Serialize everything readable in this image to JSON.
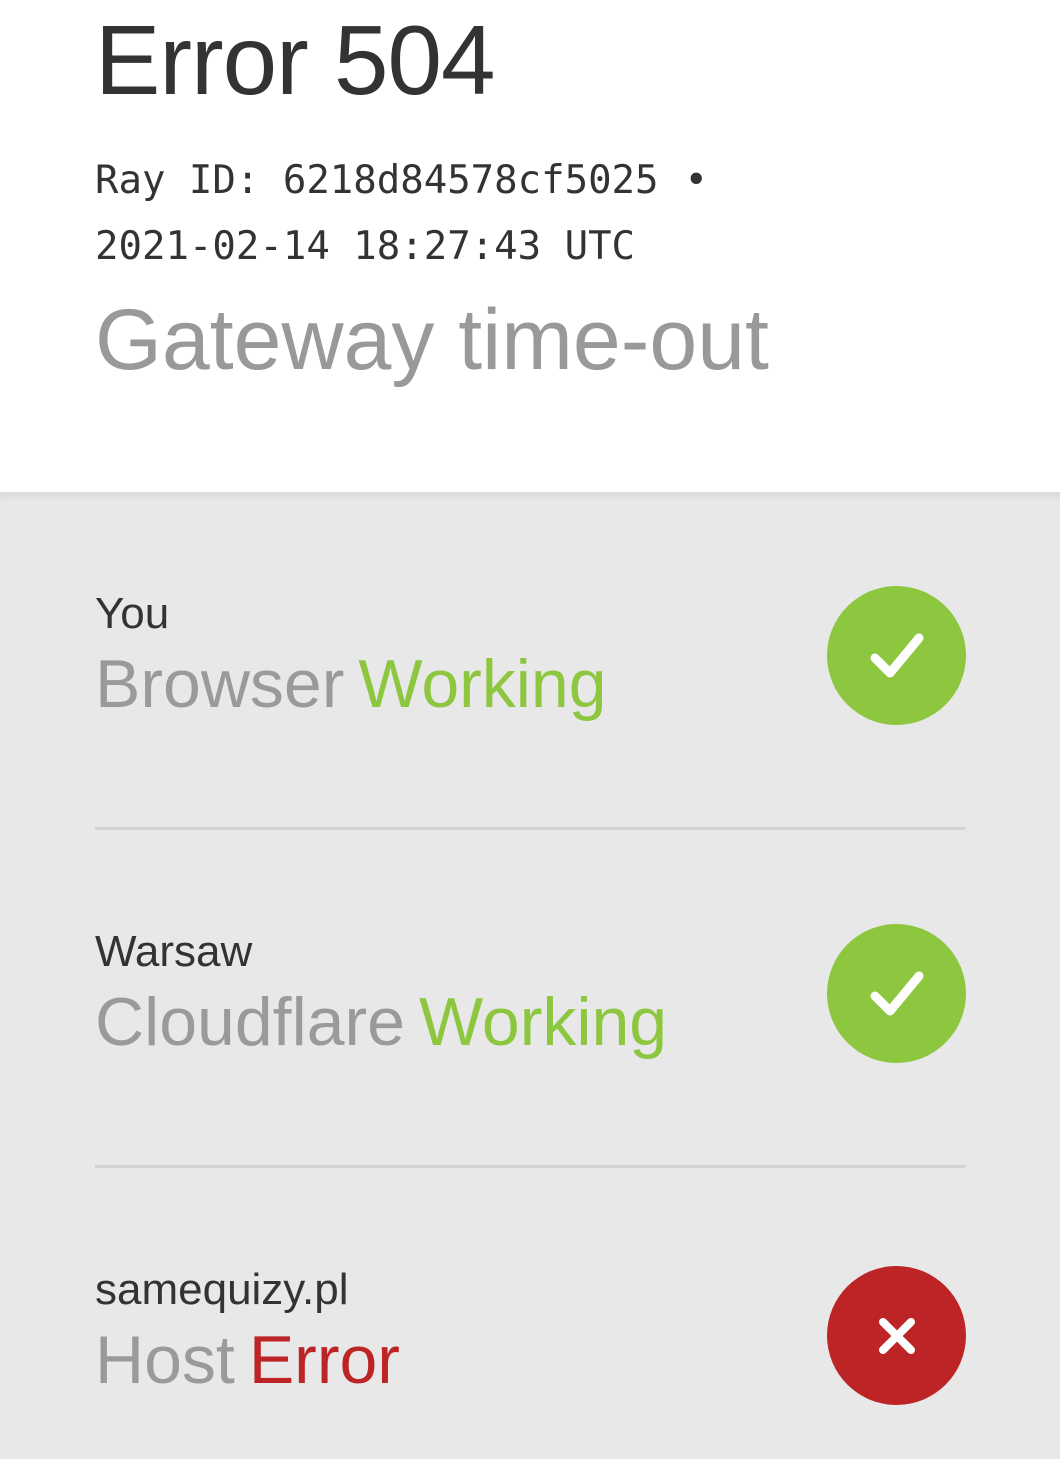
{
  "header": {
    "error_title": "Error 504",
    "ray_label": "Ray ID: 6218d84578cf5025",
    "ray_separator": "•",
    "timestamp": "2021-02-14 18:27:43 UTC",
    "subtitle": "Gateway time-out"
  },
  "status_rows": [
    {
      "location": "You",
      "name": "Browser",
      "state": "Working",
      "icon": "check-icon",
      "state_color": "#8dc63f"
    },
    {
      "location": "Warsaw",
      "name": "Cloudflare",
      "state": "Working",
      "icon": "check-icon",
      "state_color": "#8dc63f"
    },
    {
      "location": "samequizy.pl",
      "name": "Host",
      "state": "Error",
      "icon": "close-icon",
      "state_color": "#bd2426"
    }
  ],
  "colors": {
    "ok": "#8dc63f",
    "error": "#bd2426",
    "panel_bg": "#e8e8e8"
  }
}
